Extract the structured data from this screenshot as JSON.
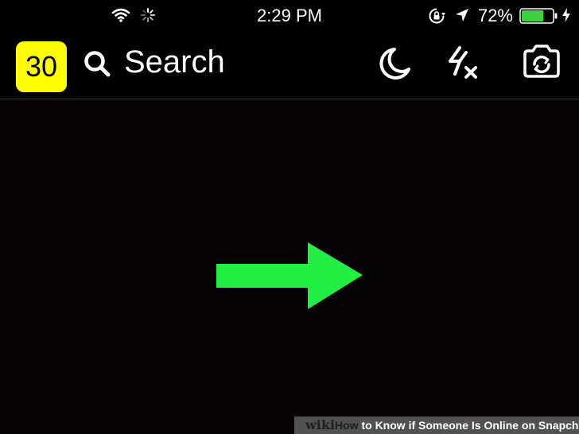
{
  "status_bar": {
    "time": "2:29 PM",
    "battery_percent": "72%",
    "battery_level": 0.72,
    "icons": [
      "wifi-icon",
      "loading-spinner-icon",
      "rotation-lock-icon",
      "location-arrow-icon",
      "battery-icon",
      "charging-bolt-icon"
    ]
  },
  "top_bar": {
    "snap_score": "30",
    "search_label": "Search",
    "icons": [
      "search-icon",
      "night-mode-moon-icon",
      "flash-off-icon",
      "flip-camera-icon"
    ]
  },
  "overlay": {
    "arrow_icon": "right-arrow-icon",
    "arrow_color": "#22ee44"
  },
  "colors": {
    "background": "#000000",
    "score_badge": "#fffc00",
    "battery_fill": "#3dd13d"
  },
  "watermark": {
    "wiki": "wiki",
    "how": "How",
    "title": " to Know if Someone Is Online on Snapchat"
  }
}
